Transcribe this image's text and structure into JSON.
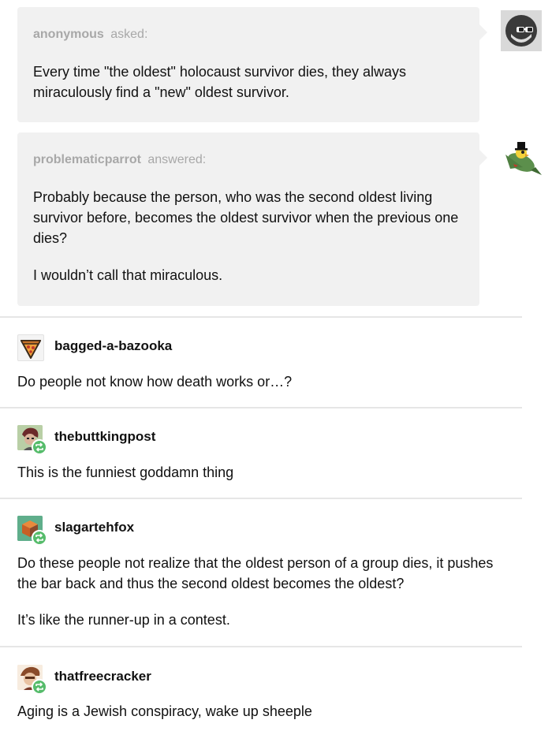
{
  "ask": {
    "asker": "anonymous",
    "verb": "asked:",
    "question": "Every time \"the oldest\" holocaust survivor dies, they always miraculously find a \"new\" oldest survivor.",
    "asker_avatar_icon": "sunglasses-face-icon"
  },
  "answer": {
    "answerer": "problematicparrot",
    "verb": "answered:",
    "paragraphs": [
      "Probably because the person, who was the second oldest living survivor before, becomes the oldest survivor when the previous one dies?",
      "I wouldn’t call that miraculous."
    ],
    "answerer_avatar_icon": "parrot-tophat-icon"
  },
  "reblogs": [
    {
      "username": "bagged-a-bazooka",
      "avatar_icon": "pizza-slice-icon",
      "reblogged": false,
      "paragraphs": [
        "Do people not know how death works or…?"
      ]
    },
    {
      "username": "thebuttkingpost",
      "avatar_icon": "character-avatar-icon",
      "reblogged": true,
      "paragraphs": [
        "This is the funniest goddamn thing"
      ]
    },
    {
      "username": "slagartehfox",
      "avatar_icon": "cube-avatar-icon",
      "reblogged": true,
      "paragraphs": [
        "Do these people not realize that the oldest person of a group dies, it pushes the bar back and thus the second oldest becomes the oldest?",
        "It’s like the runner-up in a contest."
      ]
    },
    {
      "username": "thatfreecracker",
      "avatar_icon": "character-avatar-icon",
      "reblogged": true,
      "paragraphs": [
        "Aging is a Jewish conspiracy, wake up sheeple"
      ]
    }
  ],
  "colors": {
    "bubble_bg": "#f1f1f1",
    "muted_text": "#a8a8a8",
    "reblog_badge": "#56bc6b",
    "divider": "#e6e6e6"
  }
}
